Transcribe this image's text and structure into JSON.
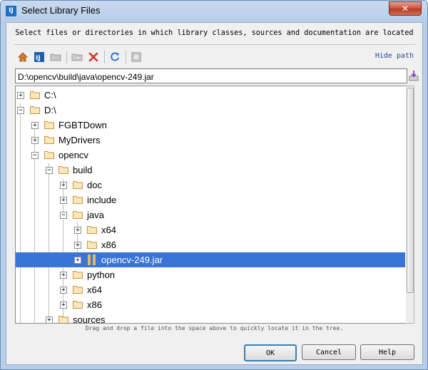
{
  "window": {
    "title": "Select Library Files"
  },
  "instruction": "Select files or directories in which library classes, sources and documentation are located",
  "toolbar": {
    "buttons": [
      {
        "name": "home-button",
        "icon": "home-icon"
      },
      {
        "name": "project-button",
        "icon": "project-icon"
      },
      {
        "name": "module-button",
        "icon": "module-folder-icon"
      },
      {
        "name": "new-folder-button",
        "icon": "new-folder-icon"
      },
      {
        "name": "delete-button",
        "icon": "delete-icon"
      },
      {
        "name": "refresh-button",
        "icon": "refresh-icon"
      },
      {
        "name": "show-hidden-button",
        "icon": "show-hidden-icon"
      }
    ],
    "hide_path_label": "Hide path"
  },
  "path": {
    "value": "D:\\opencv\\build\\java\\opencv-249.jar"
  },
  "tree": {
    "rows": [
      {
        "label": "C:\\",
        "expanded": false,
        "type": "folder",
        "selected": false
      },
      {
        "label": "D:\\",
        "expanded": true,
        "type": "folder",
        "selected": false
      },
      {
        "label": "FGBTDown",
        "expanded": false,
        "type": "folder",
        "selected": false
      },
      {
        "label": "MyDrivers",
        "expanded": false,
        "type": "folder",
        "selected": false
      },
      {
        "label": "opencv",
        "expanded": true,
        "type": "folder",
        "selected": false
      },
      {
        "label": "build",
        "expanded": true,
        "type": "folder",
        "selected": false
      },
      {
        "label": "doc",
        "expanded": false,
        "type": "folder",
        "selected": false
      },
      {
        "label": "include",
        "expanded": false,
        "type": "folder",
        "selected": false
      },
      {
        "label": "java",
        "expanded": true,
        "type": "folder",
        "selected": false
      },
      {
        "label": "x64",
        "expanded": false,
        "type": "folder",
        "selected": false
      },
      {
        "label": "x86",
        "expanded": false,
        "type": "folder",
        "selected": false
      },
      {
        "label": "opencv-249.jar",
        "expanded": false,
        "type": "jar",
        "selected": true
      },
      {
        "label": "python",
        "expanded": false,
        "type": "folder",
        "selected": false
      },
      {
        "label": "x64",
        "expanded": false,
        "type": "folder",
        "selected": false
      },
      {
        "label": "x86",
        "expanded": false,
        "type": "folder",
        "selected": false
      },
      {
        "label": "sources",
        "expanded": false,
        "type": "folder",
        "selected": false
      }
    ]
  },
  "hint": "Drag and drop a file into the space above to quickly locate it in the tree.",
  "buttons": {
    "ok": "OK",
    "cancel": "Cancel",
    "help": "Help"
  },
  "colors": {
    "selection": "#3b74d7",
    "folder": "#e2b86a",
    "title_bar": "#b7cde8",
    "link": "#1f4c8f"
  }
}
